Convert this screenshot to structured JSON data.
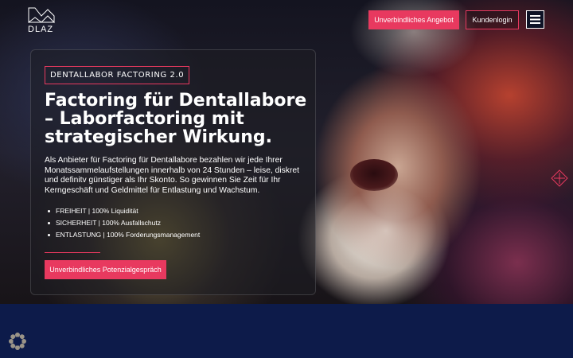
{
  "brand": {
    "logo_text": "DLAZ"
  },
  "header": {
    "offer_button": "Unverbindliches Angebot",
    "login_button": "Kundenlogin",
    "menu_icon": "hamburger-icon"
  },
  "hero": {
    "eyebrow": "DENTALLABOR FACTORING 2.0",
    "headline": "Factoring für Dentallabore – Laborfactoring mit strategischer Wirkung.",
    "body": "Als Anbieter für Factoring für Dentallabore bezahlen wir jede Ihrer Monatssammelaufstellungen innerhalb von 24 Stunden – leise, diskret und definitv günstiger als Ihr Skonto. So gewinnen Sie Zeit für Ihr Kerngeschäft und Geldmittel für Entlastung und Wachstum.",
    "features": [
      "FREIHEIT | 100% Liquidität",
      "SICHERHEIT | 100% Ausfallschutz",
      "ENTLASTUNG | 100% Forderungsmanagement"
    ],
    "cta_button": "Unverbindliches Potenzialgespräch"
  },
  "icons": {
    "side_icon": "diamond-crosshair-icon",
    "widget_icon": "flower-badge-icon"
  },
  "colors": {
    "accent": "#e8395f",
    "band": "#0d1b4a"
  }
}
